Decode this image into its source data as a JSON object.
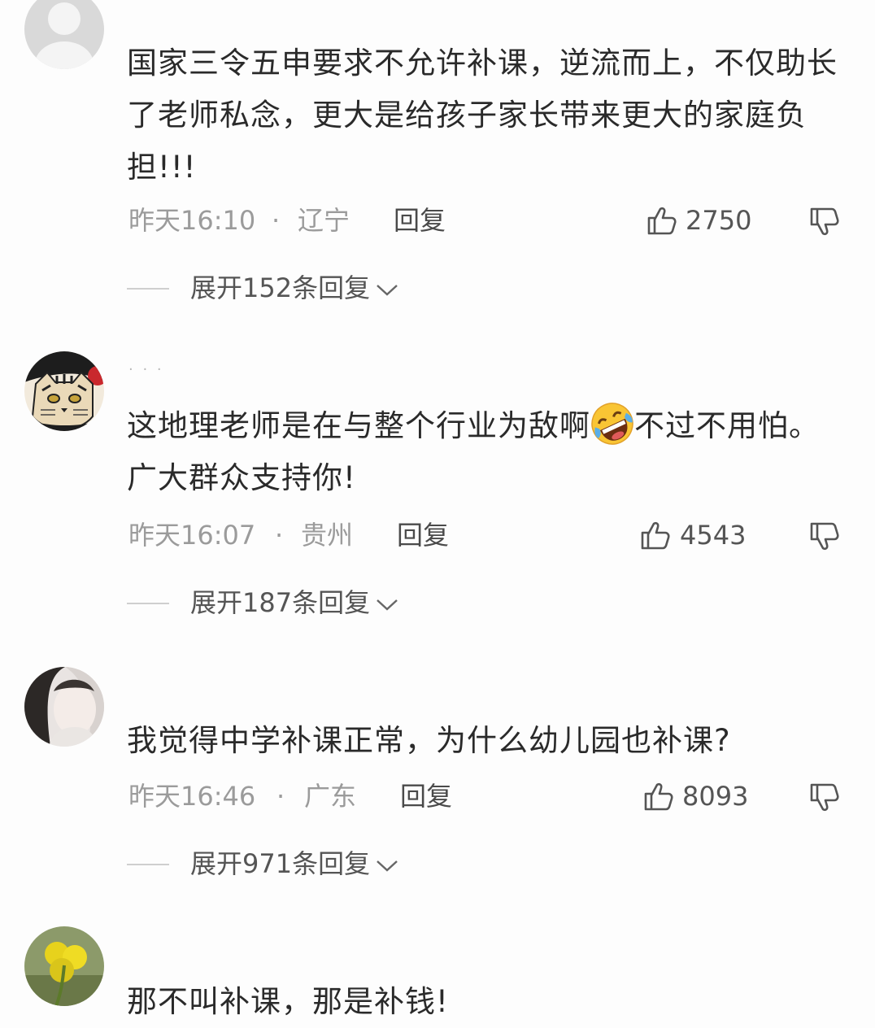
{
  "comments": [
    {
      "avatar": "default-avatar",
      "nickname": "",
      "text": "国家三令五申要求不允许补课，逆流而上，不仅助长了老师私念，更大是给孩子家长带来更大的家庭负担!!!",
      "time": "昨天16:10",
      "location": "辽宁",
      "reply_label": "回复",
      "likes": "2750",
      "expand_label": "展开152条回复"
    },
    {
      "avatar": "cat-avatar",
      "nickname": "· · ·",
      "text_before_emoji": "这地理老师是在与整个行业为敌啊",
      "emoji": "rolling-laughing-emoji",
      "text_after_emoji": "不过不用怕。广大群众支持你!",
      "time": "昨天16:07",
      "location": "贵州",
      "reply_label": "回复",
      "likes": "4543",
      "expand_label": "展开187条回复"
    },
    {
      "avatar": "girl-avatar",
      "nickname": "",
      "text": "我觉得中学补课正常，为什么幼儿园也补课?",
      "time": "昨天16:46",
      "location": "广东",
      "reply_label": "回复",
      "likes": "8093",
      "expand_label": "展开971条回复"
    },
    {
      "avatar": "clover-avatar",
      "nickname": "",
      "text": "那不叫补课，那是补钱!"
    }
  ],
  "separator": "·",
  "icons": {
    "like": "thumbs-up-icon",
    "dislike": "thumbs-down-icon",
    "expand": "chevron-down-icon"
  },
  "colors": {
    "background": "#fdfdfd",
    "text": "#2a2a2a",
    "meta": "#9b9b9b"
  }
}
